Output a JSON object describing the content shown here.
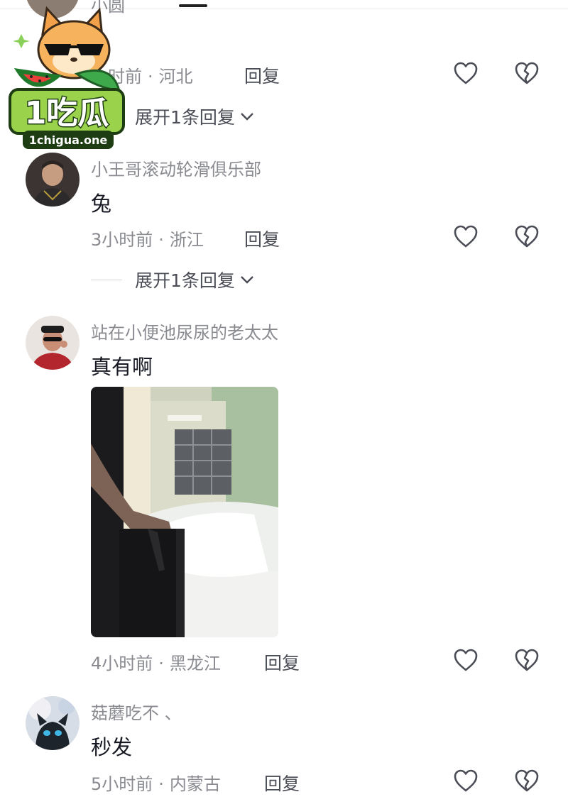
{
  "watermark": {
    "brand": "1吃瓜",
    "domain": "1chigua.one"
  },
  "comments": [
    {
      "username": "小圆",
      "text": "",
      "time": "小时前",
      "location": "河北",
      "reply_label": "回复",
      "expand_label": "展开1条回复"
    },
    {
      "username": "小王哥滚动轮滑俱乐部",
      "text": "兔",
      "time": "3小时前",
      "location": "浙江",
      "reply_label": "回复",
      "expand_label": "展开1条回复"
    },
    {
      "username": "站在小便池尿尿的老太太",
      "text": "真有啊",
      "time": "4小时前",
      "location": "黑龙江",
      "reply_label": "回复"
    },
    {
      "username": "菇蘑吃不 、",
      "text": "秒发",
      "time": "5小时前",
      "location": "内蒙古",
      "reply_label": "回复"
    }
  ],
  "separator": "·",
  "icons": {
    "like": "heart-outline-icon",
    "dislike": "broken-heart-icon",
    "expand": "chevron-down-icon"
  },
  "colors": {
    "username": "#8a8b91",
    "text": "#161823",
    "icon": "#4b4d56"
  }
}
